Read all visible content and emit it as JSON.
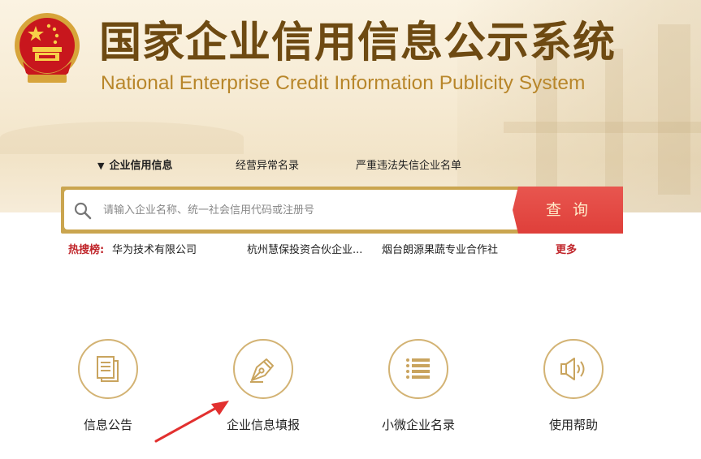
{
  "header": {
    "title_cn": "国家企业信用信息公示系统",
    "title_en": "National Enterprise Credit Information Publicity System",
    "emblem_icon": "national-emblem-icon"
  },
  "search": {
    "tabs": [
      {
        "label": "企业信用信息",
        "active": true
      },
      {
        "label": "经营异常名录",
        "active": false
      },
      {
        "label": "严重违法失信企业名单",
        "active": false
      }
    ],
    "placeholder": "请输入企业名称、统一社会信用代码或注册号",
    "button_label": "查询"
  },
  "hot_search": {
    "label": "热搜榜:",
    "items": [
      "华为技术有限公司",
      "杭州慧保投资合伙企业...",
      "烟台朗源果蔬专业合作社"
    ],
    "more_label": "更多"
  },
  "features": [
    {
      "label": "信息公告",
      "icon": "document-icon"
    },
    {
      "label": "企业信息填报",
      "icon": "pen-nib-icon"
    },
    {
      "label": "小微企业名录",
      "icon": "list-icon"
    },
    {
      "label": "使用帮助",
      "icon": "speaker-icon"
    }
  ],
  "colors": {
    "brand_gold": "#caa54f",
    "title_brown": "#6e4a12",
    "search_red": "#df3f3a",
    "hot_red": "#c0252a"
  }
}
